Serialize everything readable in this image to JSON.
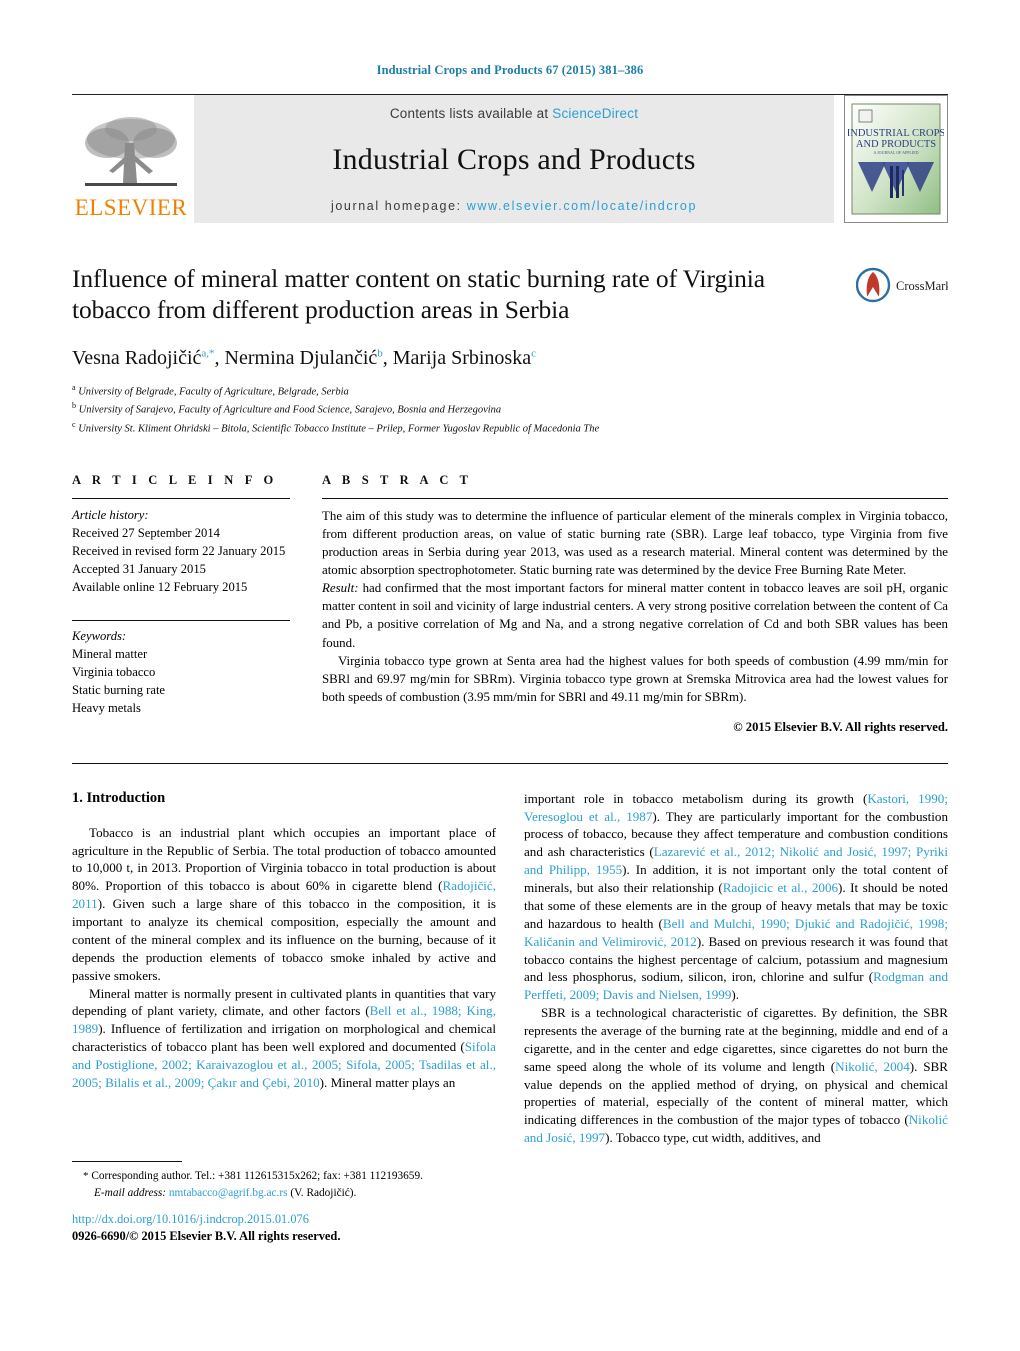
{
  "running_head": "Industrial Crops and Products 67 (2015) 381–386",
  "masthead": {
    "publisher_name": "ELSEVIER",
    "contents_prefix": "Contents lists available at ",
    "contents_link": "ScienceDirect",
    "journal_title": "Industrial Crops and Products",
    "homepage_prefix": "journal homepage: ",
    "homepage_url": "www.elsevier.com/locate/indcrop",
    "cover_line1": "INDUSTRIAL CROPS",
    "cover_line2": "AND PRODUCTS",
    "accent_color": "#2c9fd1",
    "elsevier_orange": "#f08000"
  },
  "article": {
    "title": "Influence of mineral matter content on static burning rate of Virginia tobacco from different production areas in Serbia",
    "crossmark_label": "CrossMark",
    "authors": [
      {
        "name": "Vesna Radojičić",
        "marks": "a,*"
      },
      {
        "name": "Nermina Djulančić",
        "marks": "b"
      },
      {
        "name": "Marija Srbinoska",
        "marks": "c"
      }
    ],
    "affiliations": [
      {
        "mark": "a",
        "text": "University of Belgrade, Faculty of Agriculture, Belgrade, Serbia"
      },
      {
        "mark": "b",
        "text": "University of Sarajevo, Faculty of Agriculture and Food Science, Sarajevo, Bosnia and Herzegovina"
      },
      {
        "mark": "c",
        "text": "University St. Kliment Ohridski – Bitola, Scientific Tobacco Institute – Prilep, Former Yugoslav Republic of Macedonia The"
      }
    ]
  },
  "article_info": {
    "heading": "A R T I C L E   I N F O",
    "history_label": "Article history:",
    "history": [
      "Received 27 September 2014",
      "Received in revised form 22 January 2015",
      "Accepted 31 January 2015",
      "Available online 12 February 2015"
    ],
    "keywords_label": "Keywords:",
    "keywords": [
      "Mineral matter",
      "Virginia tobacco",
      "Static burning rate",
      "Heavy metals"
    ]
  },
  "abstract": {
    "heading": "A B S T R A C T",
    "paragraph1": "The aim of this study was to determine the influence of particular element of the minerals complex in Virginia tobacco, from different production areas, on value of static burning rate (SBR). Large leaf tobacco, type Virginia from five production areas in Serbia during year 2013, was used as a research material. Mineral content was determined by the atomic absorption spectrophotometer. Static burning rate was determined by the device Free Burning Rate Meter.",
    "result_label": "Result:",
    "paragraph2": " had confirmed that the most important factors for mineral matter content in tobacco leaves are soil pH, organic matter content in soil and vicinity of large industrial centers. A very strong positive correlation between the content of Ca and Pb, a positive correlation of Mg and Na, and a strong negative correlation of Cd and both SBR values has been found.",
    "paragraph3": "Virginia tobacco type grown at Senta area had the highest values for both speeds of combustion (4.99 mm/min for SBRl and 69.97 mg/min for SBRm). Virginia tobacco type grown at Sremska Mitrovica area had the lowest values for both speeds of combustion (3.95 mm/min for SBRl and 49.11 mg/min for SBRm).",
    "copyright": "© 2015 Elsevier B.V. All rights reserved."
  },
  "introduction": {
    "number": "1.",
    "title": "Introduction",
    "left_paragraphs": [
      "Tobacco is an industrial plant which occupies an important place of agriculture in the Republic of Serbia. The total production of tobacco amounted to 10,000 t, in 2013. Proportion of Virginia tobacco in total production is about 80%. Proportion of this tobacco is about 60% in cigarette blend (Radojičić, 2011). Given such a large share of this tobacco in the composition, it is important to analyze its chemical composition, especially the amount and content of the mineral complex and its influence on the burning, because of it depends the production elements of tobacco smoke inhaled by active and passive smokers.",
      "Mineral matter is normally present in cultivated plants in quantities that vary depending of plant variety, climate, and other factors (Bell et al., 1988; King, 1989). Influence of fertilization and irrigation on morphological and chemical characteristics of tobacco plant has been well explored and documented (Sifola and Postiglione, 2002; Karaivazoglou et al., 2005; Sifola, 2005; Tsadilas et al., 2005; Bilalis et al., 2009; Çakır and Çebi, 2010). Mineral matter plays an"
    ],
    "right_paragraphs": [
      "important role in tobacco metabolism during its growth (Kastori, 1990; Veresoglou et al., 1987). They are particularly important for the combustion process of tobacco, because they affect temperature and combustion conditions and ash characteristics (Lazarević et al., 2012; Nikolić and Josić, 1997; Pyriki and Philipp, 1955). In addition, it is not important only the total content of minerals, but also their relationship (Radojicic et al., 2006). It should be noted that some of these elements are in the group of heavy metals that may be toxic and hazardous to health (Bell and Mulchi, 1990; Djukić and Radojičić, 1998; Kaličanin and Velimirović, 2012). Based on previous research it was found that tobacco contains the highest percentage of calcium, potassium and magnesium and less phosphorus, sodium, silicon, iron, chlorine and sulfur (Rodgman and Perffeti, 2009; Davis and Nielsen, 1999).",
      "SBR is a technological characteristic of cigarettes. By definition, the SBR represents the average of the burning rate at the beginning, middle and end of a cigarette, and in the center and edge cigarettes, since cigarettes do not burn the same speed along the whole of its volume and length (Nikolić, 2004). SBR value depends on the applied method of drying, on physical and chemical properties of material, especially of the content of mineral matter, which indicating differences in the combustion of the major types of tobacco (Nikolić and Josić, 1997). Tobacco type, cut width, additives, and"
    ]
  },
  "footnotes": {
    "corresponding_marker": "*",
    "corresponding_text": "Corresponding author. Tel.: +381 112615315x262; fax: +381 112193659.",
    "email_label": "E-mail address:",
    "email": "nmtabacco@agrif.bg.ac.rs",
    "email_owner": "(V. Radojičić)."
  },
  "footer": {
    "doi": "http://dx.doi.org/10.1016/j.indcrop.2015.01.076",
    "issn_line": "0926-6690/© 2015 Elsevier B.V. All rights reserved."
  }
}
